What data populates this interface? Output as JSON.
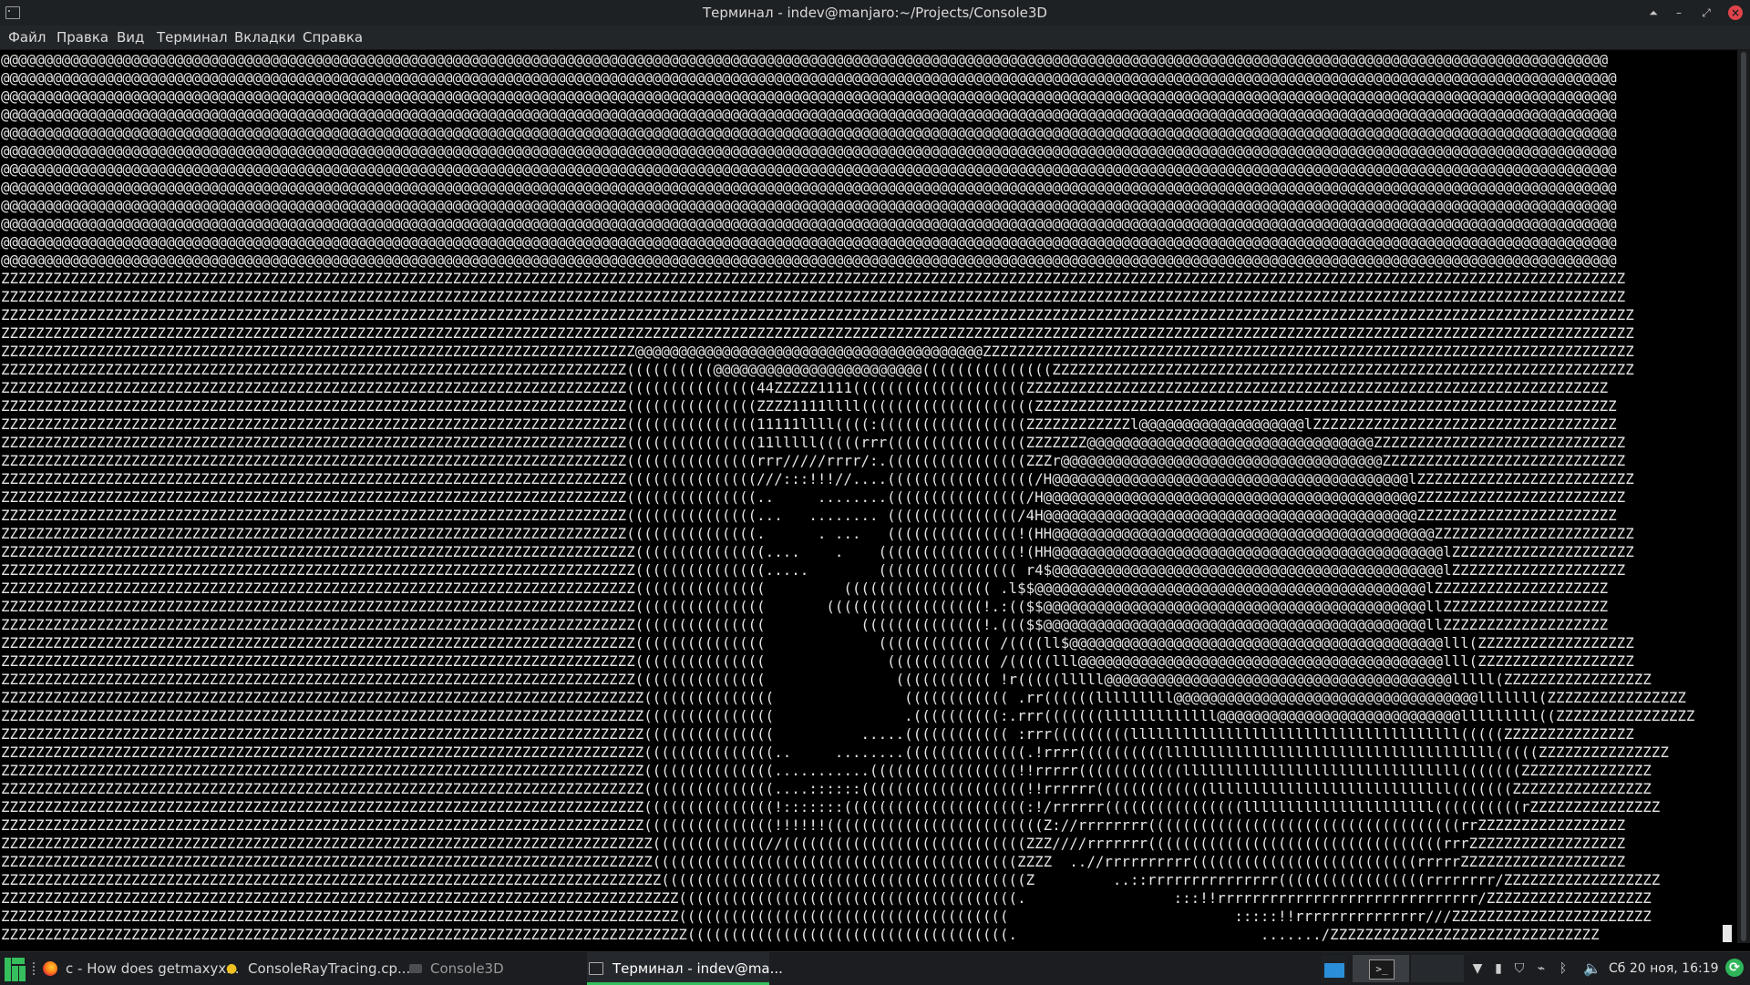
{
  "window": {
    "title": "Терминал - indev@manjaro:~/Projects/Console3D",
    "app_icon": "terminal-icon",
    "buttons": {
      "keep_above": "⏶",
      "minimize": "–",
      "maximize": "⤢",
      "close": "×"
    }
  },
  "menu": [
    "Файл",
    "Правка",
    "Вид",
    "Терминал",
    "Вкладки",
    "Справка"
  ],
  "terminal": {
    "lines": [
      "@@@@@@@@@@@@@@@@@@@@@@@@@@@@@@@@@@@@@@@@@@@@@@@@@@@@@@@@@@@@@@@@@@@@@@@@@@@@@@@@@@@@@@@@@@@@@@@@@@@@@@@@@@@@@@@@@@@@@@@@@@@@@@@@@@@@@@@@@@@@@@@@@@@@@@@@@@@@@@@@@@@@@@@@@@@@@@@@@@@@@@@@@",
      "@@@@@@@@@@@@@@@@@@@@@@@@@@@@@@@@@@@@@@@@@@@@@@@@@@@@@@@@@@@@@@@@@@@@@@@@@@@@@@@@@@@@@@@@@@@@@@@@@@@@@@@@@@@@@@@@@@@@@@@@@@@@@@@@@@@@@@@@@@@@@@@@@@@@@@@@@@@@@@@@@@@@@@@@@@@@@@@@@@@@@@@@@@",
      "@@@@@@@@@@@@@@@@@@@@@@@@@@@@@@@@@@@@@@@@@@@@@@@@@@@@@@@@@@@@@@@@@@@@@@@@@@@@@@@@@@@@@@@@@@@@@@@@@@@@@@@@@@@@@@@@@@@@@@@@@@@@@@@@@@@@@@@@@@@@@@@@@@@@@@@@@@@@@@@@@@@@@@@@@@@@@@@@@@@@@@@@@@",
      "@@@@@@@@@@@@@@@@@@@@@@@@@@@@@@@@@@@@@@@@@@@@@@@@@@@@@@@@@@@@@@@@@@@@@@@@@@@@@@@@@@@@@@@@@@@@@@@@@@@@@@@@@@@@@@@@@@@@@@@@@@@@@@@@@@@@@@@@@@@@@@@@@@@@@@@@@@@@@@@@@@@@@@@@@@@@@@@@@@@@@@@@@@",
      "@@@@@@@@@@@@@@@@@@@@@@@@@@@@@@@@@@@@@@@@@@@@@@@@@@@@@@@@@@@@@@@@@@@@@@@@@@@@@@@@@@@@@@@@@@@@@@@@@@@@@@@@@@@@@@@@@@@@@@@@@@@@@@@@@@@@@@@@@@@@@@@@@@@@@@@@@@@@@@@@@@@@@@@@@@@@@@@@@@@@@@@@@@",
      "@@@@@@@@@@@@@@@@@@@@@@@@@@@@@@@@@@@@@@@@@@@@@@@@@@@@@@@@@@@@@@@@@@@@@@@@@@@@@@@@@@@@@@@@@@@@@@@@@@@@@@@@@@@@@@@@@@@@@@@@@@@@@@@@@@@@@@@@@@@@@@@@@@@@@@@@@@@@@@@@@@@@@@@@@@@@@@@@@@@@@@@@@@",
      "@@@@@@@@@@@@@@@@@@@@@@@@@@@@@@@@@@@@@@@@@@@@@@@@@@@@@@@@@@@@@@@@@@@@@@@@@@@@@@@@@@@@@@@@@@@@@@@@@@@@@@@@@@@@@@@@@@@@@@@@@@@@@@@@@@@@@@@@@@@@@@@@@@@@@@@@@@@@@@@@@@@@@@@@@@@@@@@@@@@@@@@@@@",
      "@@@@@@@@@@@@@@@@@@@@@@@@@@@@@@@@@@@@@@@@@@@@@@@@@@@@@@@@@@@@@@@@@@@@@@@@@@@@@@@@@@@@@@@@@@@@@@@@@@@@@@@@@@@@@@@@@@@@@@@@@@@@@@@@@@@@@@@@@@@@@@@@@@@@@@@@@@@@@@@@@@@@@@@@@@@@@@@@@@@@@@@@@@",
      "@@@@@@@@@@@@@@@@@@@@@@@@@@@@@@@@@@@@@@@@@@@@@@@@@@@@@@@@@@@@@@@@@@@@@@@@@@@@@@@@@@@@@@@@@@@@@@@@@@@@@@@@@@@@@@@@@@@@@@@@@@@@@@@@@@@@@@@@@@@@@@@@@@@@@@@@@@@@@@@@@@@@@@@@@@@@@@@@@@@@@@@@@@",
      "@@@@@@@@@@@@@@@@@@@@@@@@@@@@@@@@@@@@@@@@@@@@@@@@@@@@@@@@@@@@@@@@@@@@@@@@@@@@@@@@@@@@@@@@@@@@@@@@@@@@@@@@@@@@@@@@@@@@@@@@@@@@@@@@@@@@@@@@@@@@@@@@@@@@@@@@@@@@@@@@@@@@@@@@@@@@@@@@@@@@@@@@@@",
      "@@@@@@@@@@@@@@@@@@@@@@@@@@@@@@@@@@@@@@@@@@@@@@@@@@@@@@@@@@@@@@@@@@@@@@@@@@@@@@@@@@@@@@@@@@@@@@@@@@@@@@@@@@@@@@@@@@@@@@@@@@@@@@@@@@@@@@@@@@@@@@@@@@@@@@@@@@@@@@@@@@@@@@@@@@@@@@@@@@@@@@@@@@",
      "@@@@@@@@@@@@@@@@@@@@@@@@@@@@@@@@@@@@@@@@@@@@@@@@@@@@@@@@@@@@@@@@@@@@@@@@@@@@@@@@@@@@@@@@@@@@@@@@@@@@@@@@@@@@@@@@@@@@@@@@@@@@@@@@@@@@@@@@@@@@@@@@@@@@@@@@@@@@@@@@@@@@@@@@@@@@@@@@@@@@@@@@@@",
      "ZZZZZZZZZZZZZZZZZZZZZZZZZZZZZZZZZZZZZZZZZZZZZZZZZZZZZZZZZZZZZZZZZZZZZZZZZZZZZZZZZZZZZZZZZZZZZZZZZZZZZZZZZZZZZZZZZZZZZZZZZZZZZZZZZZZZZZZZZZZZZZZZZZZZZZZZZZZZZZZZZZZZZZZZZZZZZZZZZZZZZZZZZZZ",
      "ZZZZZZZZZZZZZZZZZZZZZZZZZZZZZZZZZZZZZZZZZZZZZZZZZZZZZZZZZZZZZZZZZZZZZZZZZZZZZZZZZZZZZZZZZZZZZZZZZZZZZZZZZZZZZZZZZZZZZZZZZZZZZZZZZZZZZZZZZZZZZZZZZZZZZZZZZZZZZZZZZZZZZZZZZZZZZZZZZZZZZZZZZZZ",
      "ZZZZZZZZZZZZZZZZZZZZZZZZZZZZZZZZZZZZZZZZZZZZZZZZZZZZZZZZZZZZZZZZZZZZZZZZZZZZZZZZZZZZZZZZZZZZZZZZZZZZZZZZZZZZZZZZZZZZZZZZZZZZZZZZZZZZZZZZZZZZZZZZZZZZZZZZZZZZZZZZZZZZZZZZZZZZZZZZZZZZZZZZZZZZ",
      "ZZZZZZZZZZZZZZZZZZZZZZZZZZZZZZZZZZZZZZZZZZZZZZZZZZZZZZZZZZZZZZZZZZZZZZZZZZZZZZZZZZZZZZZZZZZZZZZZZZZZZZZZZZZZZZZZZZZZZZZZZZZZZZZZZZZZZZZZZZZZZZZZZZZZZZZZZZZZZZZZZZZZZZZZZZZZZZZZZZZZZZZZZZZZ",
      "ZZZZZZZZZZZZZZZZZZZZZZZZZZZZZZZZZZZZZZZZZZZZZZZZZZZZZZZZZZZZZZZZZZZZZZZZZ@@@@@@@@@@@@@@@@@@@@@@@@@@@@@@@@@@@@@@@@ZZZZZZZZZZZZZZZZZZZZZZZZZZZZZZZZZZZZZZZZZZZZZZZZZZZZZZZZZZZZZZZZZZZZZZZZZZZ",
      "ZZZZZZZZZZZZZZZZZZZZZZZZZZZZZZZZZZZZZZZZZZZZZZZZZZZZZZZZZZZZZZZZZZZZZZZZ((((((((((@@@@@@@@@@@@@@@@@@@@@@@@(((((((((((((((ZZZZZZZZZZZZZZZZZZZZZZZZZZZZZZZZZZZZZZZZZZZZZZZZZZZZZZZZZZZZZZZZZZZ",
      "ZZZZZZZZZZZZZZZZZZZZZZZZZZZZZZZZZZZZZZZZZZZZZZZZZZZZZZZZZZZZZZZZZZZZZZZZ(((((((((((((((44ZZZZZ1111((((((((((((((((((((ZZZZZZZZZZZZZZZZZZZZZZZZZZZZZZZZZZZZZZZZZZZZZZZZZZZZZZZZZZZZZZZZZZZ",
      "ZZZZZZZZZZZZZZZZZZZZZZZZZZZZZZZZZZZZZZZZZZZZZZZZZZZZZZZZZZZZZZZZZZZZZZZZ(((((((((((((((ZZZZ1111llll((((((((((((((((((((ZZZZZZZZZZZZZZZZZZZZZZZZZZZZZZZZZZZZZZZZZZZZZZZZZZZZZZZZZZZZZZZZZZZ",
      "ZZZZZZZZZZZZZZZZZZZZZZZZZZZZZZZZZZZZZZZZZZZZZZZZZZZZZZZZZZZZZZZZZZZZZZZZ(((((((((((((((11111llll((((:(((((((((((((((((ZZZZZZZZZZZZl@@@@@@@@@@@@@@@@@@@lZZZZZZZZZZZZZZZZZZZZZZZZZZZZZZZZZZZ",
      "ZZZZZZZZZZZZZZZZZZZZZZZZZZZZZZZZZZZZZZZZZZZZZZZZZZZZZZZZZZZZZZZZZZZZZZZZ(((((((((((((((11lllll(((((rrr((((((((((((((((ZZZZZZZ@@@@@@@@@@@@@@@@@@@@@@@@@@@@@@@@@ZZZZZZZZZZZZZZZZZZZZZZZZZZZZZ",
      "ZZZZZZZZZZZZZZZZZZZZZZZZZZZZZZZZZZZZZZZZZZZZZZZZZZZZZZZZZZZZZZZZZZZZZZZZ(((((((((((((((rrr/////rrrr/:.((((((((((((((((ZZZr@@@@@@@@@@@@@@@@@@@@@@@@@@@@@@@@@@@@@ZZZZZZZZZZZZZZZZZZZZZZZZZZZZ",
      "ZZZZZZZZZZZZZZZZZZZZZZZZZZZZZZZZZZZZZZZZZZZZZZZZZZZZZZZZZZZZZZZZZZZZZZZZ(((((((((((((((///:::!!!//....(((((((((((((((((/H@@@@@@@@@@@@@@@@@@@@@@@@@@@@@@@@@@@@@@@@@lZZZZZZZZZZZZZZZZZZZZZZZZZ",
      "ZZZZZZZZZZZZZZZZZZZZZZZZZZZZZZZZZZZZZZZZZZZZZZZZZZZZZZZZZZZZZZZZZZZZZZZZ(((((((((((((((..     ........((((((((((((((((/H@@@@@@@@@@@@@@@@@@@@@@@@@@@@@@@@@@@@@@@@@@@ZZZZZZZZZZZZZZZZZZZZZZZZ",
      "ZZZZZZZZZZZZZZZZZZZZZZZZZZZZZZZZZZZZZZZZZZZZZZZZZZZZZZZZZZZZZZZZZZZZZZZZ(((((((((((((((...   ........ (((((((((((((((/4H@@@@@@@@@@@@@@@@@@@@@@@@@@@@@@@@@@@@@@@@@@@ZZZZZZZZZZZZZZZZZZZZZZZ",
      "ZZZZZZZZZZZZZZZZZZZZZZZZZZZZZZZZZZZZZZZZZZZZZZZZZZZZZZZZZZZZZZZZZZZZZZZZ(((((((((((((((.      . ...   (((((((((((((((!(HH@@@@@@@@@@@@@@@@@@@@@@@@@@@@@@@@@@@@@@@@@@@@ZZZZZZZZZZZZZZZZZZZZZZZ",
      "ZZZZZZZZZZZZZZZZZZZZZZZZZZZZZZZZZZZZZZZZZZZZZZZZZZZZZZZZZZZZZZZZZZZZZZZZZ(((((((((((((((....    .    ((((((((((((((((!(HH@@@@@@@@@@@@@@@@@@@@@@@@@@@@@@@@@@@@@@@@@@@@@lZZZZZZZZZZZZZZZZZZZZZ",
      "ZZZZZZZZZZZZZZZZZZZZZZZZZZZZZZZZZZZZZZZZZZZZZZZZZZZZZZZZZZZZZZZZZZZZZZZZZ(((((((((((((((.....        (((((((((((((((( r4$@@@@@@@@@@@@@@@@@@@@@@@@@@@@@@@@@@@@@@@@@@@@@lZZZZZZZZZZZZZZZZZZZZ",
      "ZZZZZZZZZZZZZZZZZZZZZZZZZZZZZZZZZZZZZZZZZZZZZZZZZZZZZZZZZZZZZZZZZZZZZZZZZ(((((((((((((((         ((((((((((((((((( .l$$@@@@@@@@@@@@@@@@@@@@@@@@@@@@@@@@@@@@@@@@@@@@@lZZZZZZZZZZZZZZZZZZZZ",
      "ZZZZZZZZZZZZZZZZZZZZZZZZZZZZZZZZZZZZZZZZZZZZZZZZZZZZZZZZZZZZZZZZZZZZZZZZZ(((((((((((((((       ((((((((((((((((((!.:(($$@@@@@@@@@@@@@@@@@@@@@@@@@@@@@@@@@@@@@@@@@@@@llZZZZZZZZZZZZZZZZZZZ",
      "ZZZZZZZZZZZZZZZZZZZZZZZZZZZZZZZZZZZZZZZZZZZZZZZZZZZZZZZZZZZZZZZZZZZZZZZZZ(((((((((((((((           ((((((((((((((!.((($$@@@@@@@@@@@@@@@@@@@@@@@@@@@@@@@@@@@@@@@@@@@@llZZZZZZZZZZZZZZZZZZZ",
      "ZZZZZZZZZZZZZZZZZZZZZZZZZZZZZZZZZZZZZZZZZZZZZZZZZZZZZZZZZZZZZZZZZZZZZZZZZ(((((((((((((((             ((((((((((((( /((((ll$@@@@@@@@@@@@@@@@@@@@@@@@@@@@@@@@@@@@@@@@@@@lll(ZZZZZZZZZZZZZZZZZZ",
      "ZZZZZZZZZZZZZZZZZZZZZZZZZZZZZZZZZZZZZZZZZZZZZZZZZZZZZZZZZZZZZZZZZZZZZZZZZ(((((((((((((((              (((((((((((( /(((((lll@@@@@@@@@@@@@@@@@@@@@@@@@@@@@@@@@@@@@@@@@@lll(ZZZZZZZZZZZZZZZZZZ",
      "ZZZZZZZZZZZZZZZZZZZZZZZZZZZZZZZZZZZZZZZZZZZZZZZZZZZZZZZZZZZZZZZZZZZZZZZZZ(((((((((((((((               ((((((((((( !r(((((lllll@@@@@@@@@@@@@@@@@@@@@@@@@@@@@@@@@@@@@@@@lllll(ZZZZZZZZZZZZZZZZZ",
      "ZZZZZZZZZZZZZZZZZZZZZZZZZZZZZZZZZZZZZZZZZZZZZZZZZZZZZZZZZZZZZZZZZZZZZZZZZZ(((((((((((((((               (((((((((((( .rr((((((lllllllll@@@@@@@@@@@@@@@@@@@@@@@@@@@@@@@@@@@lllllll(ZZZZZZZZZZZZZZZZ",
      "ZZZZZZZZZZZZZZZZZZZZZZZZZZZZZZZZZZZZZZZZZZZZZZZZZZZZZZZZZZZZZZZZZZZZZZZZZZ(((((((((((((((               .((((((((((:.rrr(((((((lllllllllllll@@@@@@@@@@@@@@@@@@@@@@@@@@@@lllllllll((ZZZZZZZZZZZZZZZZ",
      "ZZZZZZZZZZZZZZZZZZZZZZZZZZZZZZZZZZZZZZZZZZZZZZZZZZZZZZZZZZZZZZZZZZZZZZZZZZ(((((((((((((((          .....(((((((((((( :rrr(((((((((llllllllllllllllllllllllllllllllllllll(((((ZZZZZZZZZZZZZZZ",
      "ZZZZZZZZZZZZZZZZZZZZZZZZZZZZZZZZZZZZZZZZZZZZZZZZZZZZZZZZZZZZZZZZZZZZZZZZZZ(((((((((((((((..     ........((((((((((((((.!rrrr((((((((((llllllllllllllllllllllllllllllllllllll(((((ZZZZZZZZZZZZZZZ",
      "ZZZZZZZZZZZZZZZZZZZZZZZZZZZZZZZZZZZZZZZZZZZZZZZZZZZZZZZZZZZZZZZZZZZZZZZZZZ(((((((((((((((...........(((((((((((((((((!!rrrrr((((((((((((llllllllllllllllllllllllllllllll(((((((ZZZZZZZZZZZZZZZ",
      "ZZZZZZZZZZZZZZZZZZZZZZZZZZZZZZZZZZZZZZZZZZZZZZZZZZZZZZZZZZZZZZZZZZZZZZZZZZ(((((((((((((((....::::::(((((((((((((((((((!!rrrrrr(((((((((((((llllllllllllllllllllllllllll(((((((ZZZZZZZZZZZZZZZZ",
      "ZZZZZZZZZZZZZZZZZZZZZZZZZZZZZZZZZZZZZZZZZZZZZZZZZZZZZZZZZZZZZZZZZZZZZZZZZZ(((((((((((((((!:::::::(((((((((((((((((((((:!/rrrrrr((((((((((((((((llllllllllllllllllllll((((((((((rZZZZZZZZZZZZZZZ",
      "ZZZZZZZZZZZZZZZZZZZZZZZZZZZZZZZZZZZZZZZZZZZZZZZZZZZZZZZZZZZZZZZZZZZZZZZZZZ(((((((((((((((!!!!!!(((((((((((((((((((((((((Z://rrrrrrrr((((((((((((((((((((((((((((((((((((rrZZZZZZZZZZZZZZZZZ",
      "ZZZZZZZZZZZZZZZZZZZZZZZZZZZZZZZZZZZZZZZZZZZZZZZZZZZZZZZZZZZZZZZZZZZZZZZZZZZ(((((((((((((//((((((((((((((((((((((((((((ZZZ////rrrrrrr((((((((((((((((((((((((((((((((((rrrZZZZZZZZZZZZZZZZZZ",
      "ZZZZZZZZZZZZZZZZZZZZZZZZZZZZZZZZZZZZZZZZZZZZZZZZZZZZZZZZZZZZZZZZZZZZZZZZZZZ((((((((((((((((((((((((((((((((((((((((((ZZZZ  ..//rrrrrrrrrr((((((((((((((((((((((((((rrrrrZZZZZZZZZZZZZZZZZZZ",
      "ZZZZZZZZZZZZZZZZZZZZZZZZZZZZZZZZZZZZZZZZZZZZZZZZZZZZZZZZZZZZZZZZZZZZZZZZZZZZ((((((((((((((((((((((((((((((((((((((((((Z         ..::rrrrrrrrrrrrrrr(((((((((((((((((rrrrrrrr/ZZZZZZZZZZZZZZZZZZ",
      "ZZZZZZZZZZZZZZZZZZZZZZZZZZZZZZZZZZZZZZZZZZZZZZZZZZZZZZZZZZZZZZZZZZZZZZZZZZZZZZ(((((((((((((((((((((((((((((((((((((((.                 :::!!rrrrrrrrrrrrrrrrrrrrrrrrrrrrrr/ZZZZZZZZZZZZZZZZZZZ",
      "ZZZZZZZZZZZZZZZZZZZZZZZZZZZZZZZZZZZZZZZZZZZZZZZZZZZZZZZZZZZZZZZZZZZZZZZZZZZZZZ((((((((((((((((((((((((((((((((((((((                          :::::!!rrrrrrrrrrrrrrr///ZZZZZZZZZZZZZZZZZZZZZZZ",
      "ZZZZZZZZZZZZZZZZZZZZZZZZZZZZZZZZZZZZZZZZZZZZZZZZZZZZZZZZZZZZZZZZZZZZZZZZZZZZZZZ(((((((((((((((((((((((((((((((((((((.                            ......./ZZZZZZZZZZZZZZZZZZZZZZZZZZZZZZZ"
    ]
  },
  "taskbar": {
    "launcher_icon": "manjaro-menu-icon",
    "tasks": [
      {
        "icon": "firefox-icon",
        "label": "c - How does getmaxyx..."
      },
      {
        "icon": "editor-icon",
        "label": "ConsoleRayTracing.cp..."
      },
      {
        "icon": "folder-icon",
        "label": "Console3D"
      },
      {
        "icon": "terminal-icon",
        "label": "Терминал - indev@ma...",
        "active": true
      }
    ],
    "pager": [
      "workspace-1",
      "workspace-2",
      "workspace-3"
    ],
    "tray_icons": [
      "network-icon",
      "battery-icon",
      "shield-icon",
      "paperclip-icon",
      "bluetooth-icon",
      "volume-icon"
    ],
    "clock": "Сб 20 ноя, 16:19",
    "update_icon": "update-icon",
    "accent": "#35bf5c"
  }
}
